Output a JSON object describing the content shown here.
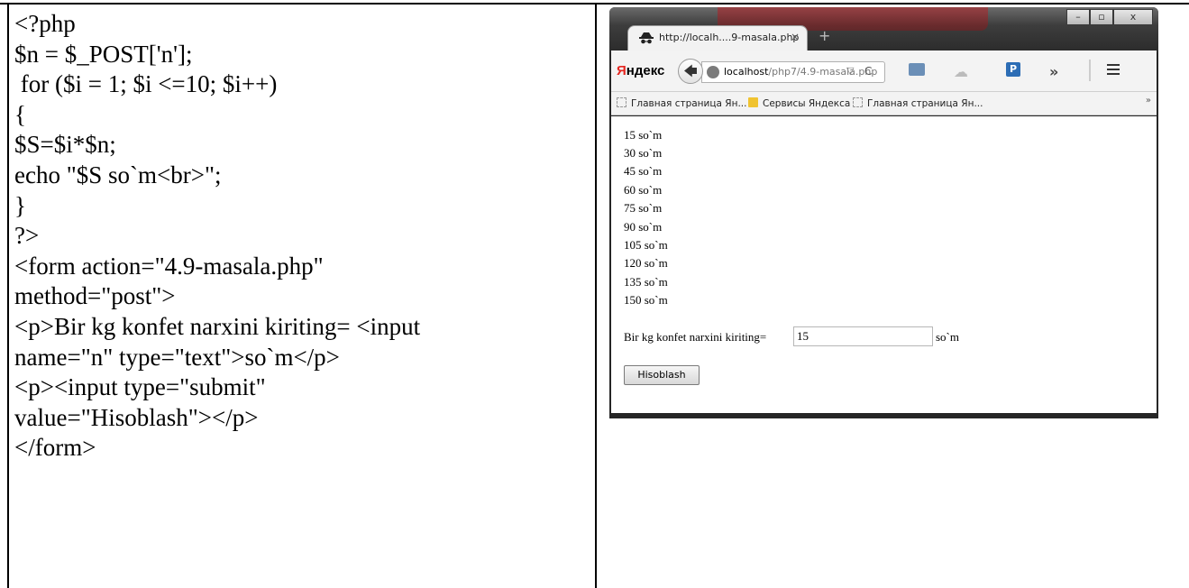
{
  "code": [
    "<?php",
    "$n = $_POST['n'];",
    " for ($i = 1; $i <=10; $i++)",
    "{",
    "$S=$i*$n;",
    "echo \"$S so`m<br>\";",
    "}",
    "?>",
    "<form action=\"4.9-masala.php\"",
    "method=\"post\">",
    "<p>Bir kg konfet narxini kiriting= <input",
    "name=\"n\" type=\"text\">so`m</p>",
    "<p><input type=\"submit\"",
    "value=\"Hisoblash\"></p>",
    "</form>"
  ],
  "browser": {
    "window_buttons": {
      "minimize": "–",
      "maximize": "▫",
      "close": "x"
    },
    "tab": {
      "title": "http://localh....9-masala.php",
      "close": "×",
      "icon": "incognito-icon"
    },
    "new_tab": "+",
    "yandex": {
      "first": "Я",
      "rest": "ндекс"
    },
    "url": {
      "host": "localhost",
      "path": "/php7/4.9-masala.php",
      "dropdown": "▽",
      "reload": "C"
    },
    "overflow": "»",
    "bookmarks": [
      {
        "label": "Главная страница Ян...",
        "icon": "page-icon"
      },
      {
        "label": "Сервисы Яндекса",
        "icon": "folder-icon"
      },
      {
        "label": "Главная страница Ян...",
        "icon": "page-icon"
      }
    ],
    "bookmarks_more": "»",
    "output": [
      "15 so`m",
      "30 so`m",
      "45 so`m",
      "60 so`m",
      "75 so`m",
      "90 so`m",
      "105 so`m",
      "120 so`m",
      "135 so`m",
      "150 so`m"
    ],
    "form": {
      "label": "Bir kg konfet narxini kiriting=",
      "input_value": "15",
      "suffix": "so`m",
      "submit": "Hisoblash"
    }
  }
}
